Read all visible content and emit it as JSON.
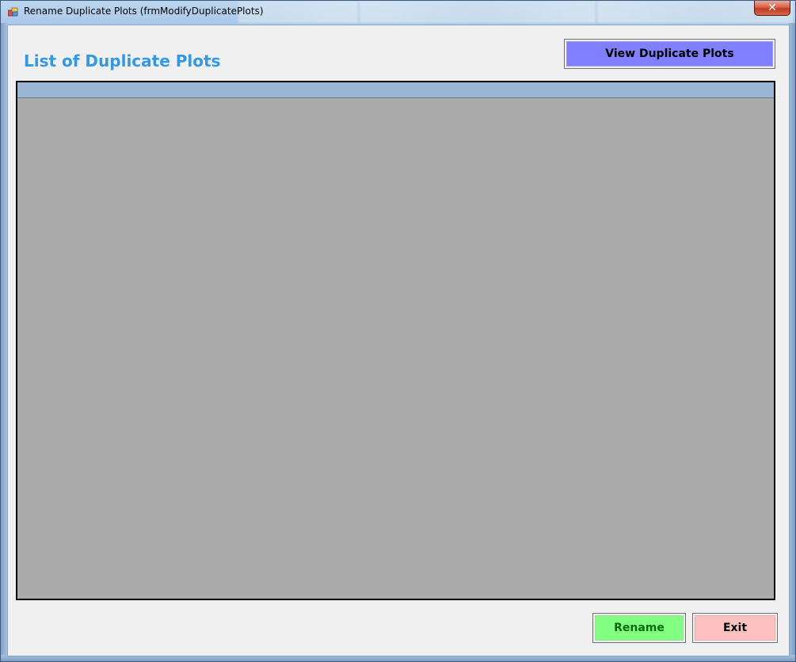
{
  "window": {
    "title": "Rename Duplicate Plots (frmModifyDuplicatePlots)",
    "close_label": "✕"
  },
  "main": {
    "heading": "List of Duplicate Plots",
    "view_button_label": "View Duplicate Plots",
    "grid": {
      "columns": [],
      "rows": []
    }
  },
  "footer": {
    "rename_label": "Rename",
    "exit_label": "Exit"
  },
  "colors": {
    "heading": "#3399e6",
    "view_button": "#7f7fff",
    "rename_button": "#80ff80",
    "exit_button": "#ffc0c0",
    "grid_background": "#ababab",
    "grid_header": "#9bb5d4"
  },
  "icons": {
    "app": "app-icon",
    "close": "close-icon"
  }
}
